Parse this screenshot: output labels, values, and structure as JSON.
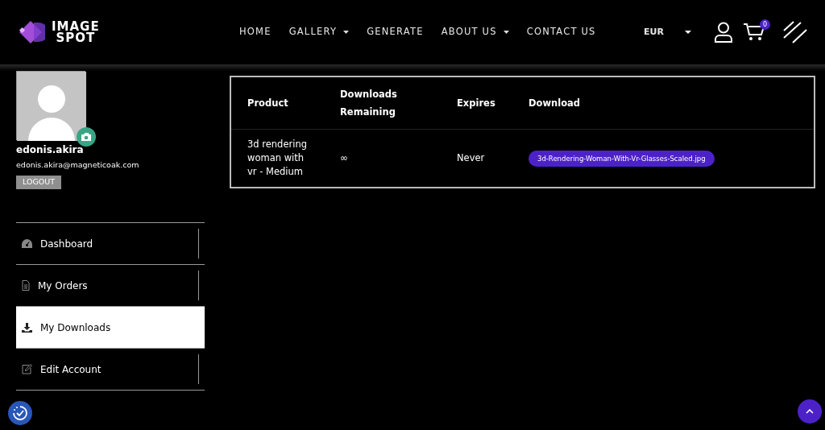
{
  "logo": {
    "line_1": "IMAGE",
    "line_2": "SPOT"
  },
  "nav": [
    {
      "label": "HOME",
      "dropdown": false
    },
    {
      "label": "GALLERY",
      "dropdown": true
    },
    {
      "label": "GENERATE",
      "dropdown": false
    },
    {
      "label": "ABOUT US",
      "dropdown": true
    },
    {
      "label": "CONTACT US",
      "dropdown": false
    }
  ],
  "currency": "EUR",
  "cart_count": "0",
  "profile": {
    "username": "edonis.akira",
    "email": "edonis.akira@magneticoak.com",
    "logout": "LOGOUT"
  },
  "sidebar": {
    "items": [
      {
        "label": "Dashboard",
        "kind": "dashboard",
        "selected": false
      },
      {
        "label": "My Orders",
        "kind": "orders",
        "selected": false
      },
      {
        "label": "My Downloads",
        "kind": "downloads",
        "selected": true
      },
      {
        "label": "Edit Account",
        "kind": "edit",
        "selected": false
      }
    ]
  },
  "table": {
    "columns": [
      {
        "label": "Product"
      },
      {
        "label": "Downloads\nRemaining"
      },
      {
        "label": "Expires"
      },
      {
        "label": "Download"
      }
    ],
    "rows": [
      {
        "product": "3d rendering woman with vr - Medium",
        "remaining": "∞",
        "expires": "Never",
        "file": "3d-Rendering-Woman-With-Vr-Glasses-Scaled.jpg"
      }
    ]
  }
}
